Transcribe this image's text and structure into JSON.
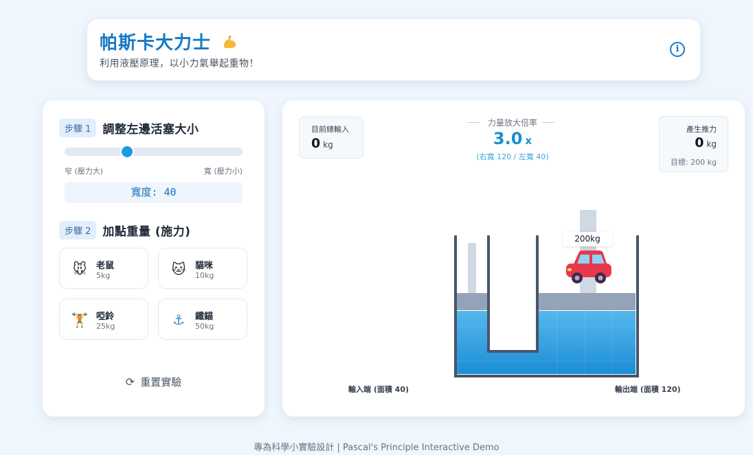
{
  "header": {
    "title": "帕斯卡大力士",
    "title_icon": "flexed-biceps-emoji",
    "subtitle": "利用液壓原理，以小力氣舉起重物！",
    "info_icon": "info-circle-icon"
  },
  "step1": {
    "badge": "步驟 1",
    "title": "調整左邊活塞大小",
    "slider_fraction": 0.35,
    "label_left": "窄 (壓力大)",
    "label_right": "寬 (壓力小)",
    "width_display": "寬度: 40"
  },
  "step2": {
    "badge": "步驟 2",
    "title": "加點重量 (施力)",
    "weights": [
      {
        "name": "老鼠",
        "kg": "5kg",
        "emoji": "🐭",
        "icon": "mouse-icon"
      },
      {
        "name": "貓咪",
        "kg": "10kg",
        "emoji": "🐱",
        "icon": "cat-icon"
      },
      {
        "name": "啞鈴",
        "kg": "25kg",
        "emoji": "🏋",
        "icon": "weightlifter-icon"
      },
      {
        "name": "鐵錨",
        "kg": "50kg",
        "emoji": "⚓",
        "icon": "anchor-icon"
      }
    ]
  },
  "reset": {
    "label": "重置實驗",
    "icon": "refresh-icon"
  },
  "stats": {
    "input_label": "目前總輸入",
    "input_value": "0",
    "input_unit": "kg",
    "mult_label": "力量放大倍率",
    "mult_value": "3.0",
    "mult_x": "x",
    "mult_sub": "(右寬 120 / 左寬 40)",
    "output_label": "產生推力",
    "output_value": "0",
    "output_unit": "kg",
    "target": "目標: 200 kg"
  },
  "apparatus": {
    "load_label": "200kg",
    "load_icon": "car-icon",
    "input_port_label": "輸入端 (面積 40)",
    "output_port_label": "輸出端 (面積 120)",
    "colors": {
      "water": "#2f9fe0",
      "piston": "#95a3b8",
      "wall": "#475569"
    }
  },
  "footer": "專為科學小實驗設計 | Pascal's Principle Interactive Demo"
}
